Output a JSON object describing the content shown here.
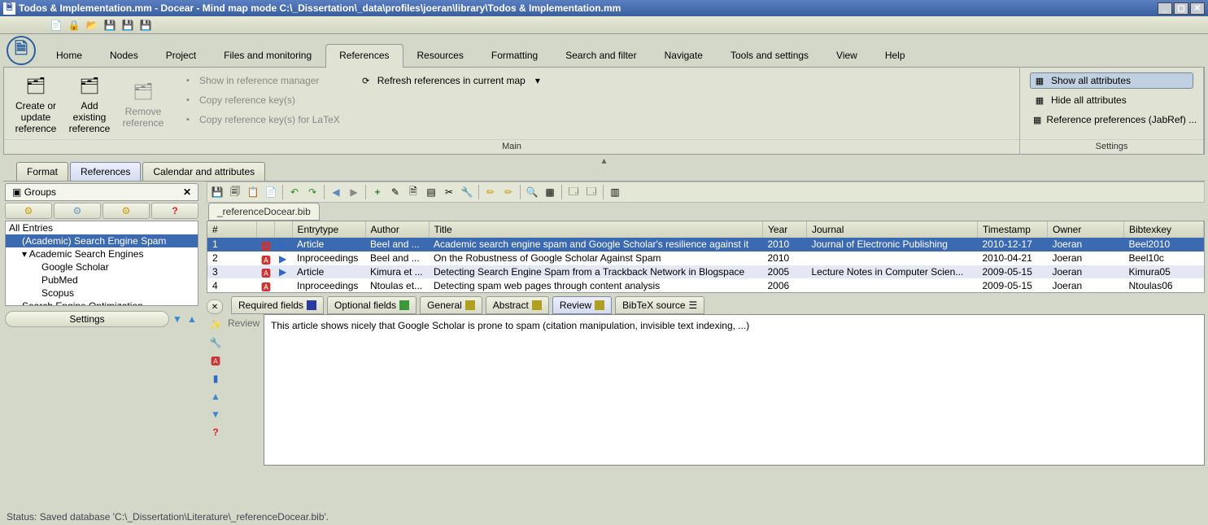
{
  "title": "Todos & Implementation.mm - Docear - Mind map mode C:\\_Dissertation\\_data\\profiles\\joeran\\library\\Todos & Implementation.mm",
  "menu": [
    "Home",
    "Nodes",
    "Project",
    "Files and monitoring",
    "References",
    "Resources",
    "Formatting",
    "Search and filter",
    "Navigate",
    "Tools and settings",
    "View",
    "Help"
  ],
  "active_menu_index": 4,
  "ribbon": {
    "main": {
      "label": "Main",
      "big_buttons": [
        {
          "label": "Create or update reference",
          "disabled": false
        },
        {
          "label": "Add existing reference",
          "disabled": false
        },
        {
          "label": "Remove reference",
          "disabled": true
        }
      ],
      "left_items": [
        {
          "label": "Show in reference manager",
          "disabled": true
        },
        {
          "label": "Copy reference key(s)",
          "disabled": true
        },
        {
          "label": "Copy reference key(s) for LaTeX",
          "disabled": true
        }
      ],
      "mid_item": {
        "label": "Refresh references in current map"
      }
    },
    "settings": {
      "label": "Settings",
      "items": [
        {
          "label": "Show all attributes",
          "pressed": true
        },
        {
          "label": "Hide all attributes",
          "pressed": false
        },
        {
          "label": "Reference preferences (JabRef) ...",
          "pressed": false
        }
      ]
    }
  },
  "subtabs": [
    "Format",
    "References",
    "Calendar and attributes"
  ],
  "active_subtab_index": 1,
  "groups": {
    "title": "Groups",
    "all_entries": "All Entries",
    "items": [
      "(Academic) Search Engine Spam",
      "Academic Search Engines",
      "Google Scholar",
      "PubMed",
      "Scopus",
      "Search Engine Optimization"
    ],
    "selected_index": 0,
    "settings_label": "Settings"
  },
  "file_tab": "_referenceDocear.bib",
  "table": {
    "headers": [
      "#",
      "",
      "",
      "Entrytype",
      "Author",
      "Title",
      "Year",
      "Journal",
      "Timestamp",
      "Owner",
      "Bibtexkey"
    ],
    "rows": [
      {
        "n": "1",
        "pdf": true,
        "web": true,
        "entrytype": "Article",
        "author": "Beel and ...",
        "title": "Academic search engine spam and Google Scholar's resilience against it",
        "year": "2010",
        "journal": "Journal of Electronic Publishing",
        "timestamp": "2010-12-17",
        "owner": "Joeran",
        "key": "Beel2010",
        "sel": true
      },
      {
        "n": "2",
        "pdf": true,
        "web": true,
        "entrytype": "Inproceedings",
        "author": "Beel and ...",
        "title": "On the Robustness of Google Scholar Against Spam",
        "year": "2010",
        "journal": "",
        "timestamp": "2010-04-21",
        "owner": "Joeran",
        "key": "Beel10c",
        "sel": false
      },
      {
        "n": "3",
        "pdf": true,
        "web": true,
        "entrytype": "Article",
        "author": "Kimura et ...",
        "title": "Detecting Search Engine Spam from a Trackback Network in Blogspace",
        "year": "2005",
        "journal": "Lecture Notes in Computer Scien...",
        "timestamp": "2009-05-15",
        "owner": "Joeran",
        "key": "Kimura05",
        "sel": false,
        "alt": true
      },
      {
        "n": "4",
        "pdf": true,
        "web": false,
        "entrytype": "Inproceedings",
        "author": "Ntoulas et...",
        "title": "Detecting spam web pages through content analysis",
        "year": "2006",
        "journal": "",
        "timestamp": "2009-05-15",
        "owner": "Joeran",
        "key": "Ntoulas06",
        "sel": false
      }
    ]
  },
  "detail_tabs": [
    {
      "label": "Required fields",
      "color": "#2a3aa0"
    },
    {
      "label": "Optional fields",
      "color": "#3a9a3a"
    },
    {
      "label": "General",
      "color": "#b0a020"
    },
    {
      "label": "Abstract",
      "color": "#b0a020"
    },
    {
      "label": "Review",
      "color": "#b0a020"
    },
    {
      "label": "BibTeX source",
      "color": ""
    }
  ],
  "active_detail_index": 4,
  "review_label": "Review",
  "review_text": "This article shows nicely that Google Scholar is prone to spam (citation manipulation, invisible text indexing, ...)",
  "status": "Status: Saved database 'C:\\_Dissertation\\Literature\\_referenceDocear.bib'."
}
